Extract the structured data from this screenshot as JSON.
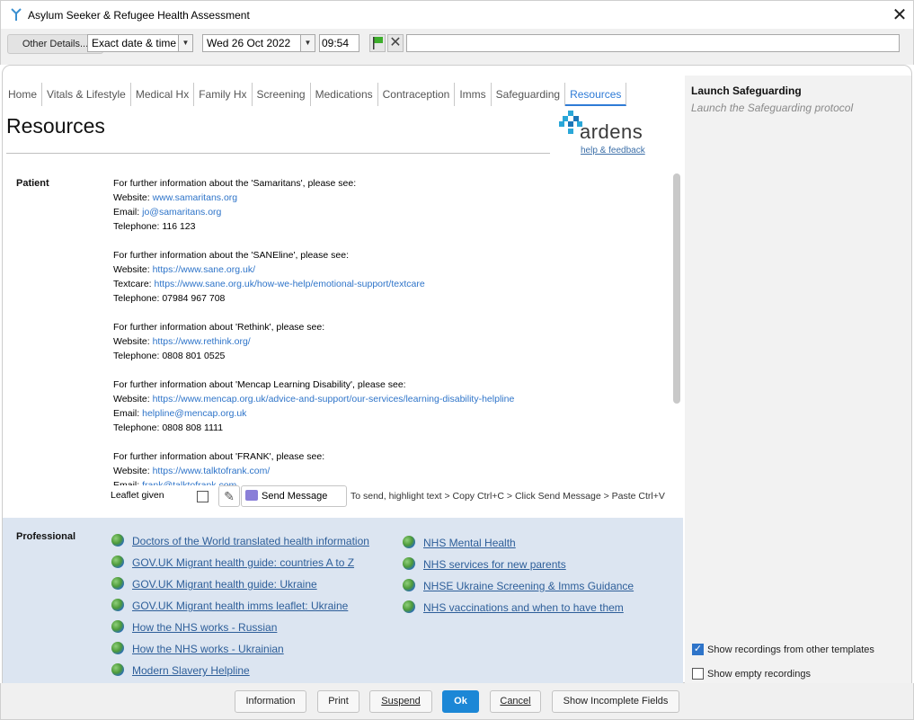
{
  "window": {
    "title": "Asylum Seeker & Refugee Health Assessment"
  },
  "toolbar": {
    "other_details": "Other Details...",
    "date_mode": "Exact date & time",
    "date": "Wed 26 Oct 2022",
    "time": "09:54"
  },
  "tabs": [
    "Home",
    "Vitals & Lifestyle",
    "Medical Hx",
    "Family Hx",
    "Screening",
    "Medications",
    "Contraception",
    "Imms",
    "Safeguarding",
    "Resources"
  ],
  "active_tab": "Resources",
  "page": {
    "title": "Resources",
    "logo_text": "ardens",
    "help_link": "help & feedback"
  },
  "patient": {
    "label": "Patient",
    "blocks": [
      {
        "intro": "For further information about the 'Samaritans', please see:",
        "lines": [
          {
            "k": "Website:",
            "v": "www.samaritans.org",
            "link": true
          },
          {
            "k": "Email:",
            "v": "jo@samaritans.org",
            "link": true
          },
          {
            "k": "Telephone:",
            "v": "116 123",
            "link": false
          }
        ]
      },
      {
        "intro": "For further information about the 'SANEline', please see:",
        "lines": [
          {
            "k": "Website:",
            "v": "https://www.sane.org.uk/",
            "link": true
          },
          {
            "k": "Textcare:",
            "v": "https://www.sane.org.uk/how-we-help/emotional-support/textcare",
            "link": true
          },
          {
            "k": "Telephone:",
            "v": "07984 967 708",
            "link": false
          }
        ]
      },
      {
        "intro": "For further information about 'Rethink', please see:",
        "lines": [
          {
            "k": "Website:",
            "v": "https://www.rethink.org/",
            "link": true
          },
          {
            "k": "Telephone:",
            "v": "0808 801 0525",
            "link": false
          }
        ]
      },
      {
        "intro": "For further information about 'Mencap Learning Disability', please see:",
        "lines": [
          {
            "k": "Website:",
            "v": "https://www.mencap.org.uk/advice-and-support/our-services/learning-disability-helpline",
            "link": true
          },
          {
            "k": "Email:",
            "v": "helpline@mencap.org.uk",
            "link": true
          },
          {
            "k": "Telephone:",
            "v": "0808 808 1111",
            "link": false
          }
        ]
      },
      {
        "intro": "For further information about 'FRANK', please see:",
        "lines": [
          {
            "k": "Website:",
            "v": "https://www.talktofrank.com/",
            "link": true
          },
          {
            "k": "Email:",
            "v": "frank@talktofrank.com",
            "link": true
          }
        ]
      }
    ],
    "leaflet_label": "Leaflet given",
    "send_message": "Send Message",
    "send_hint": "To send, highlight text > Copy Ctrl+C > Click Send Message > Paste Ctrl+V"
  },
  "professional": {
    "label": "Professional",
    "left_links": [
      "Doctors of the World translated health information",
      "GOV.UK Migrant health guide: countries A to Z",
      "GOV.UK Migrant health guide: Ukraine",
      "GOV.UK Migrant health imms leaflet: Ukraine",
      "How the NHS works - Russian ",
      "How the NHS works - Ukrainian",
      "Modern Slavery Helpline"
    ],
    "right_links": [
      "NHS Mental Health",
      "NHS services for new parents",
      "NHSE Ukraine Screening & Imms Guidance",
      "NHS vaccinations and when to have them"
    ]
  },
  "side": {
    "title": "Launch Safeguarding",
    "subtitle": "Launch the Safeguarding protocol",
    "opt_show_other": "Show recordings from other templates",
    "opt_show_other_checked": true,
    "opt_show_empty": "Show empty recordings",
    "opt_show_empty_checked": false
  },
  "footer": {
    "information": "Information",
    "print": "Print",
    "suspend": "Suspend",
    "ok": "Ok",
    "cancel": "Cancel",
    "show_incomplete": "Show Incomplete Fields"
  },
  "colors": {
    "accent": "#2e7bd6",
    "ok_button": "#1c87d6",
    "professional_band": "#dce5f1"
  }
}
